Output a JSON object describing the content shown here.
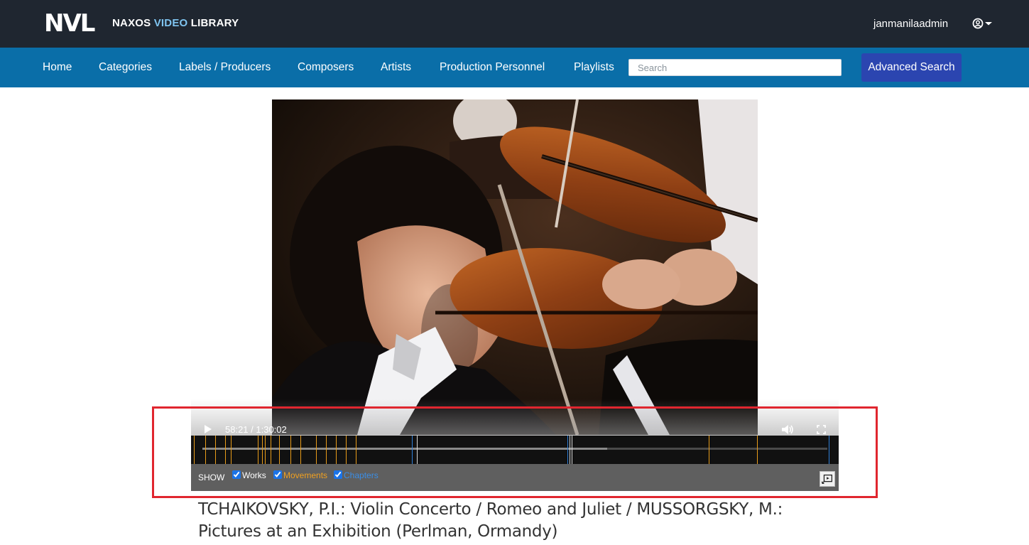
{
  "header": {
    "logo_text": "NVL",
    "brand_part1": "NAXOS ",
    "brand_part2": "VIDEO",
    "brand_part3": " LIBRARY",
    "username": "janmanilaadmin",
    "user_menu_icon": "user-circle-icon"
  },
  "nav": {
    "items": [
      {
        "label": "Home"
      },
      {
        "label": "Categories"
      },
      {
        "label": "Labels / Producers"
      },
      {
        "label": "Composers"
      },
      {
        "label": "Artists"
      },
      {
        "label": "Production Personnel"
      },
      {
        "label": "Playlists"
      }
    ],
    "search_placeholder": "Search",
    "advanced_search_label": "Advanced Search"
  },
  "player": {
    "current_time": "58:21",
    "duration": "1:30:02",
    "time_display": "58:21 / 1:30:02",
    "progress_fraction": 0.648,
    "play_icon": "play-icon",
    "volume_icon": "volume-icon",
    "fullscreen_icon": "fullscreen-icon",
    "pip_icon": "picture-in-picture-icon",
    "show": {
      "label": "SHOW",
      "works": {
        "label": "Works",
        "checked": true
      },
      "movements": {
        "label": "Movements",
        "checked": true
      },
      "chapters": {
        "label": "Chapters",
        "checked": true
      }
    },
    "marker_colors": {
      "movement": "#e89c1a",
      "chapter": "#2f7fd8",
      "work": "#d9d9d9"
    }
  },
  "video": {
    "title": "TCHAIKOVSKY, P.I.: Violin Concerto / Romeo and Juliet / MUSSORGSKY, M.: Pictures at an Exhibition (Perlman, Ormandy)"
  }
}
